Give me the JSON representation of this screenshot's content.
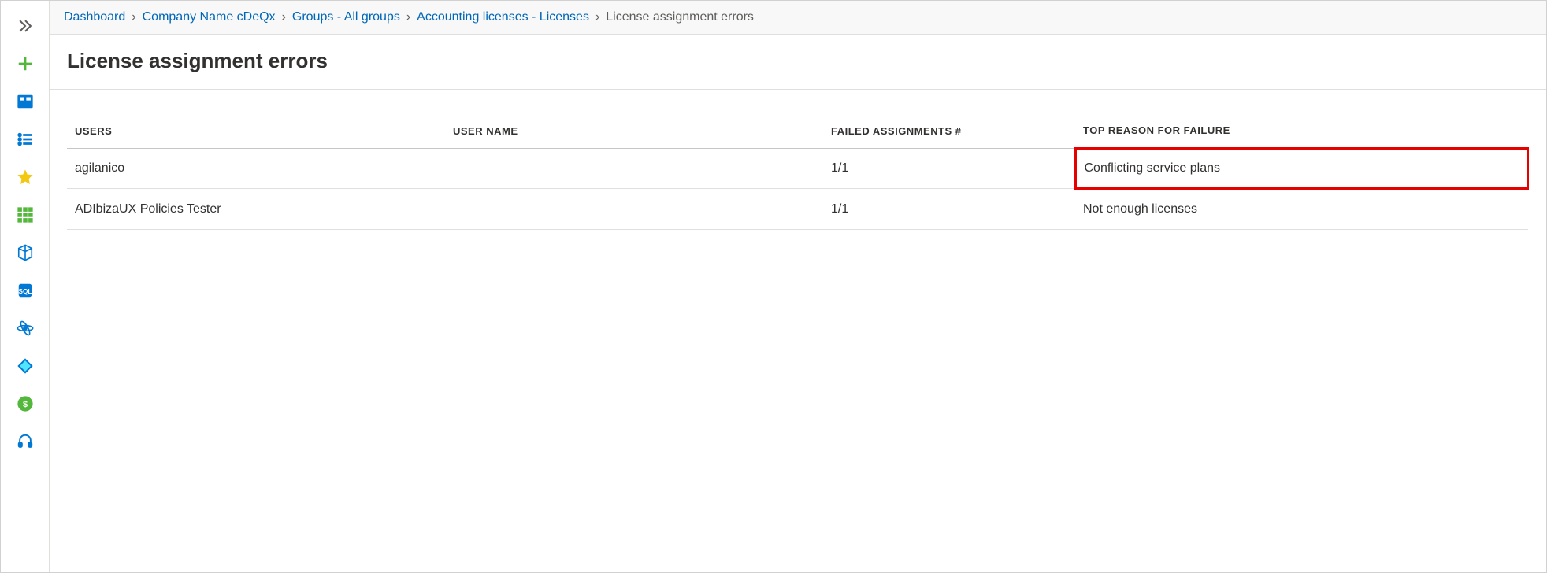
{
  "breadcrumb": {
    "items": [
      {
        "label": "Dashboard"
      },
      {
        "label": "Company Name cDeQx"
      },
      {
        "label": "Groups - All groups"
      },
      {
        "label": "Accounting licenses - Licenses"
      }
    ],
    "current": "License assignment errors"
  },
  "page": {
    "title": "License assignment errors"
  },
  "table": {
    "headers": {
      "users": "USERS",
      "username": "USER NAME",
      "failed": "FAILED ASSIGNMENTS #",
      "reason": "TOP REASON FOR FAILURE"
    },
    "rows": [
      {
        "users": "agilanico",
        "username": "",
        "failed": "1/1",
        "reason": "Conflicting service plans",
        "highlight": true
      },
      {
        "users": "ADIbizaUX Policies Tester",
        "username": "",
        "failed": "1/1",
        "reason": "Not enough licenses",
        "highlight": false
      }
    ]
  }
}
